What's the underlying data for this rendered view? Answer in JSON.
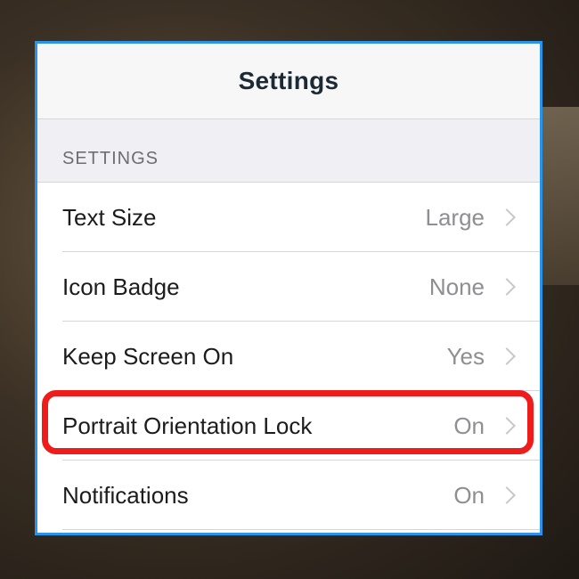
{
  "header": {
    "title": "Settings"
  },
  "section": {
    "label": "SETTINGS"
  },
  "rows": [
    {
      "label": "Text Size",
      "value": "Large"
    },
    {
      "label": "Icon Badge",
      "value": "None"
    },
    {
      "label": "Keep Screen On",
      "value": "Yes"
    },
    {
      "label": "Portrait Orientation Lock",
      "value": "On"
    },
    {
      "label": "Notifications",
      "value": "On"
    }
  ],
  "colors": {
    "panel_border": "#2a93ea",
    "highlight": "#ef1c1c",
    "value_text": "#8e8e93"
  }
}
